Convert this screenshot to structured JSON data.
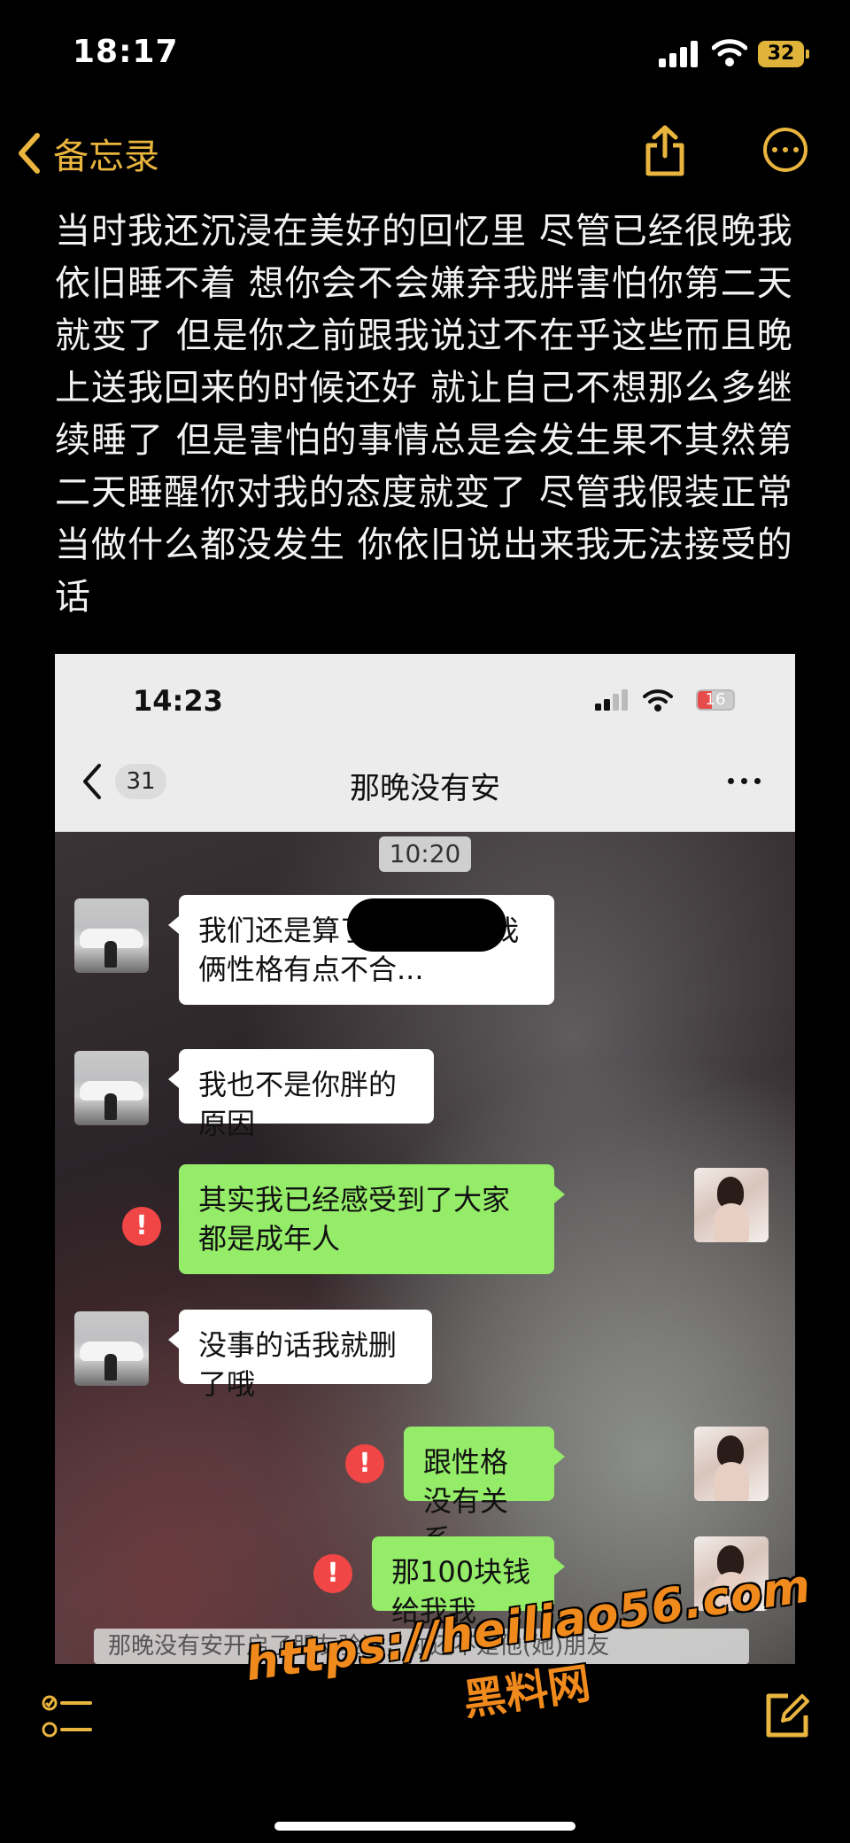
{
  "status": {
    "time": "18:17",
    "battery": "32"
  },
  "nav": {
    "back_label": "备忘录"
  },
  "note": {
    "text": "当时我还沉浸在美好的回忆里 尽管已经很晚我依旧睡不着 想你会不会嫌弃我胖害怕你第二天就变了 但是你之前跟我说过不在乎这些而且晚上送我回来的时候还好 就让自己不想那么多继续睡了 但是害怕的事情总是会发生果不其然第二天睡醒你对我的态度就变了 尽管我假装正常当做什么都没发生 你依旧说出来我无法接受的话"
  },
  "chat": {
    "status_time": "14:23",
    "battery": "16",
    "unread_count": "31",
    "contact_name": "那晚没有安",
    "timestamp": "10:20",
    "messages": [
      {
        "side": "left",
        "text": "我们还是算了吧 我感觉我俩性格有点不合..."
      },
      {
        "side": "left",
        "text": "我也不是你胖的原因"
      },
      {
        "side": "right",
        "text": "其实我已经感受到了大家都是成年人",
        "failed": true
      },
      {
        "side": "left",
        "text": "没事的话我就删了哦"
      },
      {
        "side": "right",
        "text": "跟性格没有关系",
        "failed": true
      },
      {
        "side": "right",
        "text": "那100块钱给我我",
        "failed": true
      }
    ],
    "system_notice": "那晚没有安开启了朋友验证，你还不是他(她)朋友"
  },
  "watermark": {
    "url": "https://heiliao56.com",
    "name": "黑料网"
  },
  "colors": {
    "accent": "#e9b53f",
    "bubble_green": "#95ec69",
    "error_red": "#f04646",
    "watermark": "#f08a1c"
  },
  "icons": [
    "chevron-left-icon",
    "share-icon",
    "more-icon",
    "checklist-icon",
    "compose-icon"
  ]
}
